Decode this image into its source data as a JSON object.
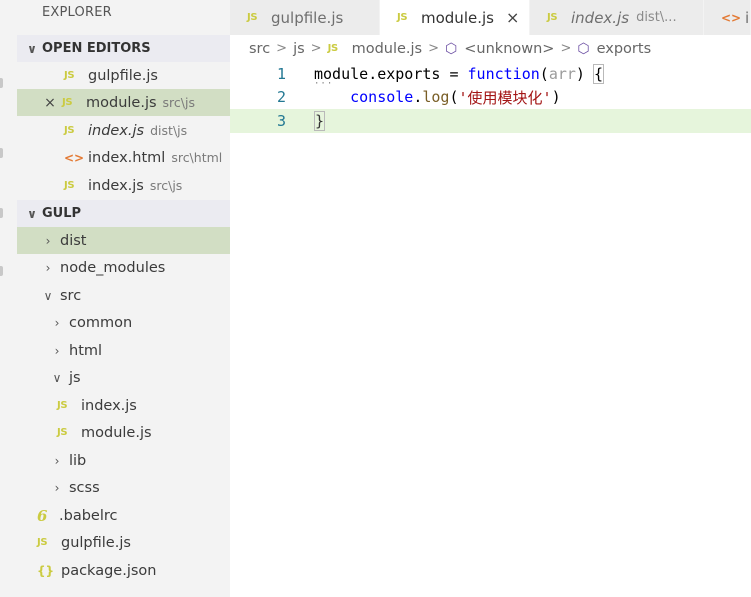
{
  "explorer": {
    "title": "EXPLORER",
    "open_editors": {
      "header": "OPEN EDITORS",
      "items": [
        {
          "name": "gulpfile.js",
          "desc": "",
          "icon": "js-icon",
          "italic": false,
          "selected": false,
          "close": false
        },
        {
          "name": "module.js",
          "desc": "src\\js",
          "icon": "js-icon",
          "italic": false,
          "selected": true,
          "close": true
        },
        {
          "name": "index.js",
          "desc": "dist\\js",
          "icon": "js-icon",
          "italic": true,
          "selected": false,
          "close": false
        },
        {
          "name": "index.html",
          "desc": "src\\html",
          "icon": "html-icon",
          "italic": false,
          "selected": false,
          "close": false
        },
        {
          "name": "index.js",
          "desc": "src\\js",
          "icon": "js-icon",
          "italic": false,
          "selected": false,
          "close": false
        }
      ]
    },
    "workspace": {
      "header": "GULP",
      "items": [
        {
          "name": "dist",
          "kind": "folder",
          "expanded": false,
          "selected": true
        },
        {
          "name": "node_modules",
          "kind": "folder",
          "expanded": false,
          "selected": false
        },
        {
          "name": "src",
          "kind": "folder",
          "expanded": true,
          "selected": false
        },
        {
          "name": "common",
          "kind": "folder",
          "expanded": false,
          "selected": false
        },
        {
          "name": "html",
          "kind": "folder",
          "expanded": false,
          "selected": false
        },
        {
          "name": "js",
          "kind": "folder",
          "expanded": true,
          "selected": false
        },
        {
          "name": "index.js",
          "kind": "file",
          "icon": "js-icon",
          "selected": false
        },
        {
          "name": "module.js",
          "kind": "file",
          "icon": "js-icon",
          "selected": false
        },
        {
          "name": "lib",
          "kind": "folder",
          "expanded": false,
          "selected": false
        },
        {
          "name": "scss",
          "kind": "folder",
          "expanded": false,
          "selected": false
        },
        {
          "name": ".babelrc",
          "kind": "file",
          "icon": "babel-icon",
          "selected": false
        },
        {
          "name": "gulpfile.js",
          "kind": "file",
          "icon": "js-icon",
          "selected": false
        },
        {
          "name": "package.json",
          "kind": "file",
          "icon": "json-icon",
          "selected": false
        }
      ]
    }
  },
  "icons": {
    "js": "JS",
    "html": "<>",
    "babel": "6",
    "json": "{}",
    "close": "×",
    "chevron_down": "∨",
    "chevron_right": "›",
    "breadcrumb_sep": ">",
    "symbol": "⬡"
  },
  "tabs": [
    {
      "label": "gulpfile.js",
      "desc": "",
      "italic": false,
      "active": false,
      "icon": "js-icon"
    },
    {
      "label": "module.js",
      "desc": "",
      "italic": false,
      "active": true,
      "icon": "js-icon",
      "close": "×"
    },
    {
      "label": "index.js",
      "desc": "dist\\...",
      "italic": true,
      "active": false,
      "icon": "js-icon"
    },
    {
      "label": "in",
      "desc": "",
      "italic": false,
      "active": false,
      "icon": "html-icon"
    }
  ],
  "breadcrumb": {
    "parts": [
      "src",
      "js",
      "module.js",
      "<unknown>",
      "exports"
    ]
  },
  "code": {
    "lines": [
      {
        "number": "1"
      },
      {
        "number": "2"
      },
      {
        "number": "3"
      }
    ],
    "tokens": {
      "l1_module": "module",
      "l1_exports": ".exports",
      "l1_eq": " = ",
      "l1_function": "function",
      "l1_paren_open": "(",
      "l1_param": "arr",
      "l1_paren_close": ") ",
      "l1_brace": "{",
      "l2_indent": "    ",
      "l2_console": "console",
      "l2_dot": ".",
      "l2_log": "log",
      "l2_paren_open": "(",
      "l2_string": "'使用模块化'",
      "l2_paren_close": ")",
      "l3_brace": "}"
    }
  },
  "colors": {
    "sidebar_bg": "#f3f3f3",
    "selected_row": "#d2dec4",
    "current_line": "#e6f5dc",
    "keyword": "#0000ff",
    "string": "#a31515",
    "function": "#795e26",
    "line_number": "#237893"
  }
}
